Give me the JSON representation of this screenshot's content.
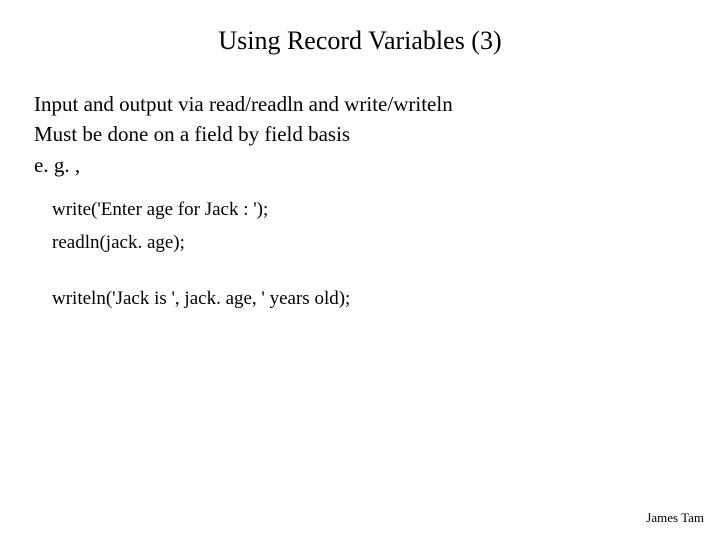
{
  "title": "Using Record Variables (3)",
  "body": {
    "line1": "Input and output via read/readln and write/writeln",
    "line2": "Must be done on a field by field basis",
    "line3": "e. g. ,"
  },
  "code": {
    "line1": "write('Enter age for Jack : ');",
    "line2": " readln(jack. age);",
    "line3": "writeln('Jack is ', jack. age, ' years old);"
  },
  "footer": "James Tam"
}
